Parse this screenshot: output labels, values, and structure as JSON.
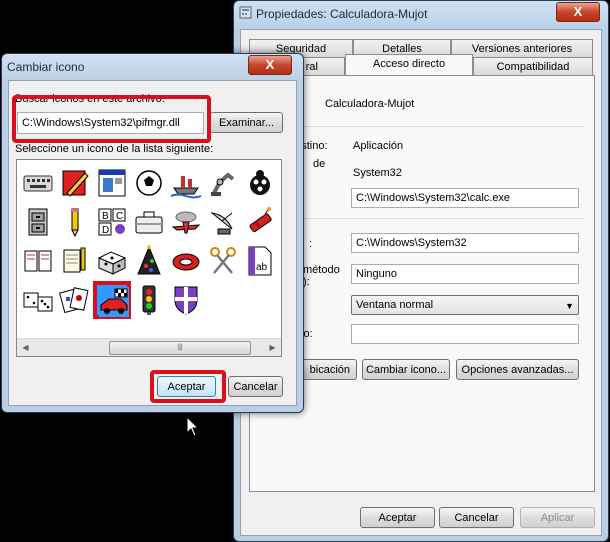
{
  "props": {
    "title": "Propiedades: Calculadora-Mujot",
    "close_glyph": "X",
    "tabs_top": [
      "Seguridad",
      "Detalles",
      "Versiones anteriores"
    ],
    "tabs_bottom": [
      "ral",
      "Acceso directo",
      "Compatibilidad"
    ],
    "name": "Calculadora-Mujot",
    "label_tipo": "destino:",
    "value_tipo": "Aplicación",
    "label_ubic": "de",
    "value_ubic": "System32",
    "destino": "C:\\Windows\\System32\\calc.exe",
    "label_iniciar": ":",
    "iniciar": "C:\\Windows\\System32",
    "label_metodo": "método",
    "label_metodo2": "):",
    "metodo": "Ninguno",
    "ejecutar": "Ventana normal",
    "label_comentario": "io:",
    "comentario": "",
    "btn_ubicacion": "bicación",
    "btn_cambiar": "Cambiar icono...",
    "btn_opciones": "Opciones avanzadas...",
    "btn_aceptar": "Aceptar",
    "btn_cancelar": "Cancelar",
    "btn_aplicar": "Aplicar"
  },
  "change_icon": {
    "title": "Cambiar icono",
    "close_glyph": "X",
    "search_label": "Buscar iconos en este archivo:",
    "file_path": "C:\\Windows\\System32\\pifmgr.dll",
    "browse_button": "Examinar...",
    "list_label": "Seleccione un icono de la lista siguiente:",
    "ok_button": "Aceptar",
    "cancel_button": "Cancelar",
    "scroll_left": "◀",
    "scroll_right": "▶",
    "scroll_thumb": "|||",
    "icons": [
      "keyboard-icon",
      "pencil-paint-icon",
      "window-app-icon",
      "soccer-ball-icon",
      "ship-icon",
      "robot-arm-icon",
      "ladybug-icon",
      "cabinet-icon",
      "pencil-icon",
      "alphabet-blocks-icon",
      "briefcase-icon",
      "airplane-icon",
      "satellite-dish-icon",
      "dynamite-icon",
      "book-icon",
      "notepad-pencil-icon",
      "dice-icon",
      "party-hat-icon",
      "lifebuoy-icon",
      "scissors-icon",
      "document-ab-icon",
      "dice-pair-icon",
      "playing-cards-icon",
      "race-car-icon",
      "traffic-light-icon",
      "shield-icon"
    ]
  }
}
